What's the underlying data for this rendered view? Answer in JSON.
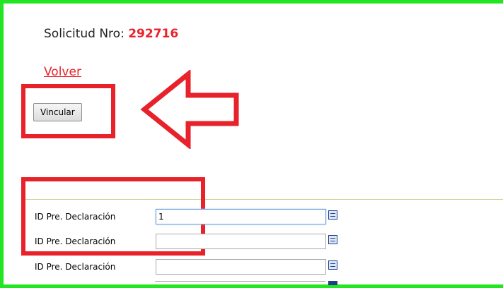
{
  "header": {
    "solicitud_label": "Solicitud Nro:",
    "solicitud_number": "292716"
  },
  "actions": {
    "volver_link": "Volver",
    "vincular_button": "Vincular"
  },
  "form": {
    "rows": [
      {
        "label": "ID Pre. Declaración",
        "value": "1"
      },
      {
        "label": "ID Pre. Declaración",
        "value": ""
      },
      {
        "label": "ID Pre. Declaración",
        "value": ""
      }
    ]
  },
  "colors": {
    "frame": "#22e622",
    "highlight": "#e8222a",
    "number": "#e8222a",
    "divider": "#c7d68f"
  },
  "icons": [
    "picker-icon",
    "arrow-icon"
  ]
}
